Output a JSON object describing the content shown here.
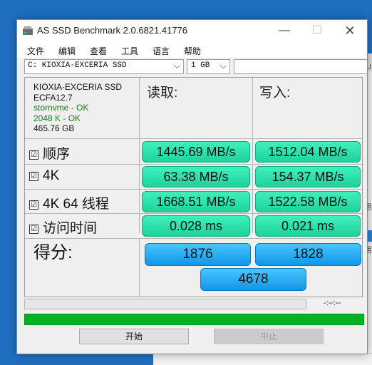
{
  "window": {
    "title": "AS SSD Benchmark 2.0.6821.41776",
    "min_symbol": "—",
    "max_symbol": "☐",
    "close_symbol": "✕"
  },
  "menu": [
    "文件",
    "编辑",
    "查看",
    "工具",
    "语言",
    "帮助"
  ],
  "toolbar": {
    "drive_value": "C: KIOXIA-EXCERIA SSD",
    "size_value": "1 GB",
    "dropdown_arrow": "⌵"
  },
  "drive_info": {
    "model": "KIOXIA-EXCERIA SSD",
    "firmware": "ECFA12.7",
    "driver": "stornvme - OK",
    "alignment": "2048 K - OK",
    "capacity": "465.76 GB"
  },
  "columns": {
    "read": "读取:",
    "write": "写入:"
  },
  "rows": [
    {
      "label": "顺序",
      "checked": "☑",
      "read": "1445.69 MB/s",
      "write": "1512.04 MB/s"
    },
    {
      "label": "4K",
      "checked": "☑",
      "read": "63.38 MB/s",
      "write": "154.37 MB/s"
    },
    {
      "label": "4K 64 线程",
      "checked": "☑",
      "read": "1668.51 MB/s",
      "write": "1522.58 MB/s"
    },
    {
      "label": "访问时间",
      "checked": "☑",
      "read": "0.028 ms",
      "write": "0.021 ms"
    }
  ],
  "score": {
    "label": "得分:",
    "read": "1876",
    "write": "1828",
    "total": "4678"
  },
  "progress": {
    "time": "-:--:--",
    "fraction": 0
  },
  "buttons": {
    "start": "开始",
    "stop": "中止"
  },
  "background": {
    "glyph1": "\\U",
    "glyph2": "用",
    "glyph3": "用"
  },
  "colors": {
    "value_box": "#2ee0ab",
    "score_box": "#28aef5",
    "progress_green": "#06b025",
    "info_green": "#1c7c1c"
  }
}
